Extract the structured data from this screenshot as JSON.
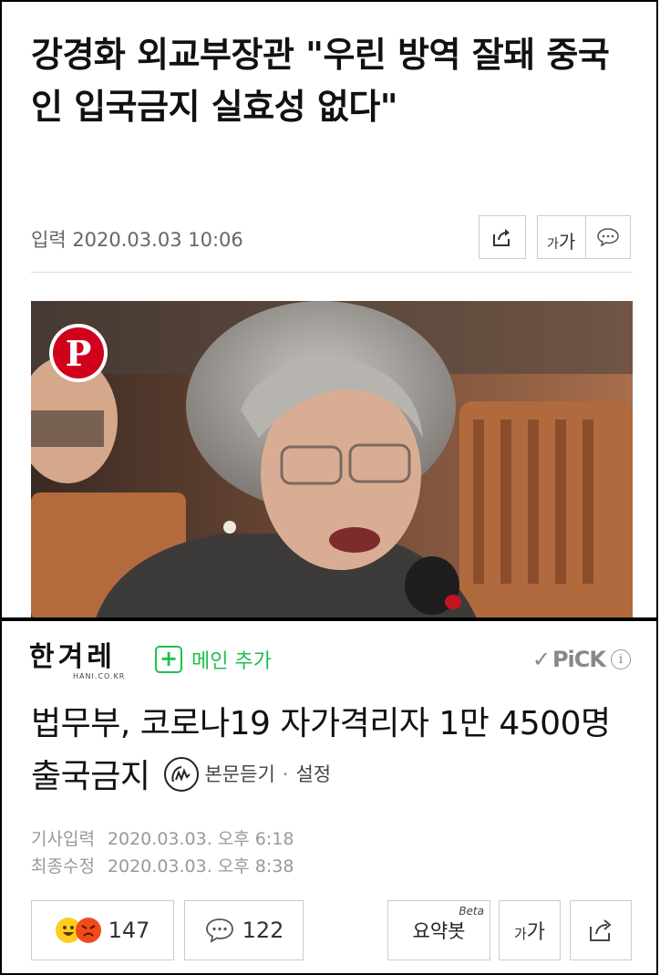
{
  "article1": {
    "headline": "강경화 외교부장관 \"우린 방역 잘돼 중국인 입국금지 실효성 없다\"",
    "date": "입력 2020.03.03 10:06",
    "font_small": "가",
    "font_large": "가"
  },
  "article2": {
    "logo_text": "한겨레",
    "logo_sub": "HANI.CO.KR",
    "add_main_icon": "+",
    "add_main_label": "메인 추가",
    "pick_label": "PiCK",
    "info_icon": "i",
    "title": "법무부, 코로나19 자가격리자 1만 4500명 출국금지",
    "listen_label": "본문듣기",
    "settings_label": "설정",
    "published_label": "기사입력",
    "published": "2020.03.03. 오후 6:18",
    "modified_label": "최종수정",
    "modified": "2020.03.03. 오후 8:38",
    "reaction_count": "147",
    "comment_count": "122",
    "summary_label": "요약봇",
    "summary_beta": "Beta",
    "font_small": "가",
    "font_large": "가"
  },
  "colors": {
    "accent_green": "#1fbf4e",
    "pinterest_red": "#d0021b"
  },
  "icons": [
    "share-icon",
    "comment-icon",
    "pinterest-icon",
    "check-icon",
    "info-icon",
    "audio-icon",
    "happy-emoji-icon",
    "angry-emoji-icon"
  ]
}
